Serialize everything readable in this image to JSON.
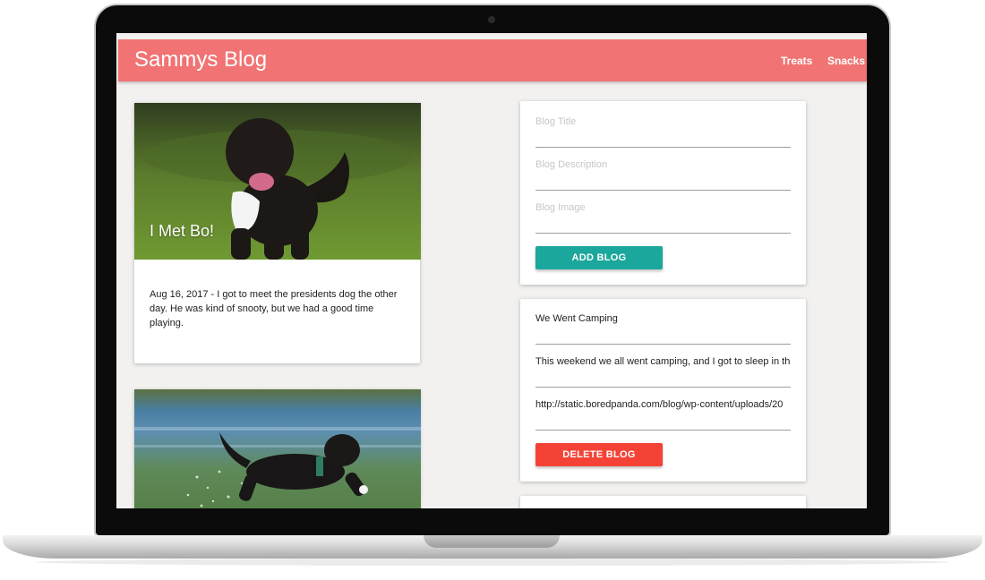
{
  "app": {
    "brand": "Sammys Blog",
    "nav": [
      "Treats",
      "Snacks"
    ],
    "colors": {
      "topbar": "#f17373",
      "add_button": "#1ba79b",
      "delete_button": "#f44336",
      "screen_bg": "#f2f1ef"
    }
  },
  "posts": [
    {
      "title": "I Met Bo!",
      "text": "Aug 16, 2017 - I got to meet the presidents dog the other day. He was kind of snooty, but we had a good time playing.",
      "image": "black-dog-on-grass-photo"
    },
    {
      "image": "black-dog-running-in-water-photo"
    }
  ],
  "add_form": {
    "title_placeholder": "Blog Title",
    "description_placeholder": "Blog Description",
    "image_placeholder": "Blog Image",
    "button_label": "ADD BLOG"
  },
  "edit_form": {
    "title_value": "We Went Camping",
    "description_value": "This weekend we all went camping, and I got to sleep in the",
    "image_value": "http://static.boredpanda.com/blog/wp-content/uploads/20",
    "button_label": "DELETE BLOG"
  }
}
